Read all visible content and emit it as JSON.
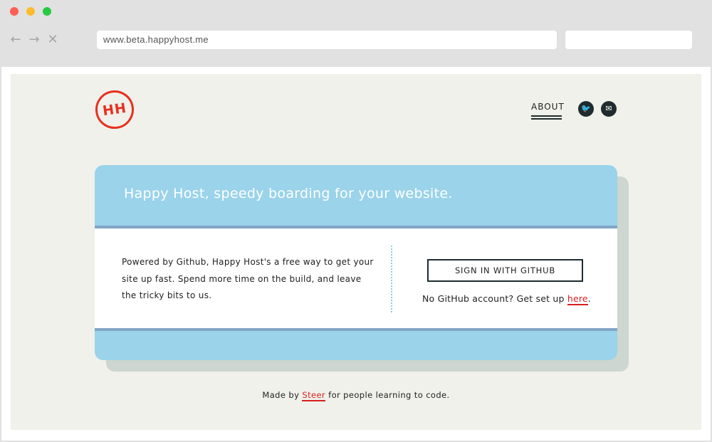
{
  "browser": {
    "url": "www.beta.happyhost.me",
    "nav": {
      "back_icon": "←",
      "forward_icon": "→",
      "close_icon": "✕"
    }
  },
  "site": {
    "logo_text": "HH",
    "about_label": "ABOUT",
    "social": {
      "twitter_icon": "🐦",
      "mail_icon": "✉"
    }
  },
  "hero": {
    "title": "Happy Host, speedy boarding for your website.",
    "description": "Powered by Github, Happy Host's a free way to get your site up fast. Spend more time on the build, and leave the tricky bits to us.",
    "signin_label": "SIGN IN WITH GITHUB",
    "no_account_prefix": "No GitHub account? Get set up ",
    "no_account_link": "here",
    "no_account_suffix": "."
  },
  "footer": {
    "prefix": "Made by ",
    "link": "Steer",
    "suffix": " for people learning to code."
  },
  "colors": {
    "accent_red": "#e8301f",
    "card_blue": "#9ad3ea",
    "card_stripe": "#81a5c6",
    "page_bg": "#f0f1ea",
    "dark": "#1f2b2f"
  }
}
